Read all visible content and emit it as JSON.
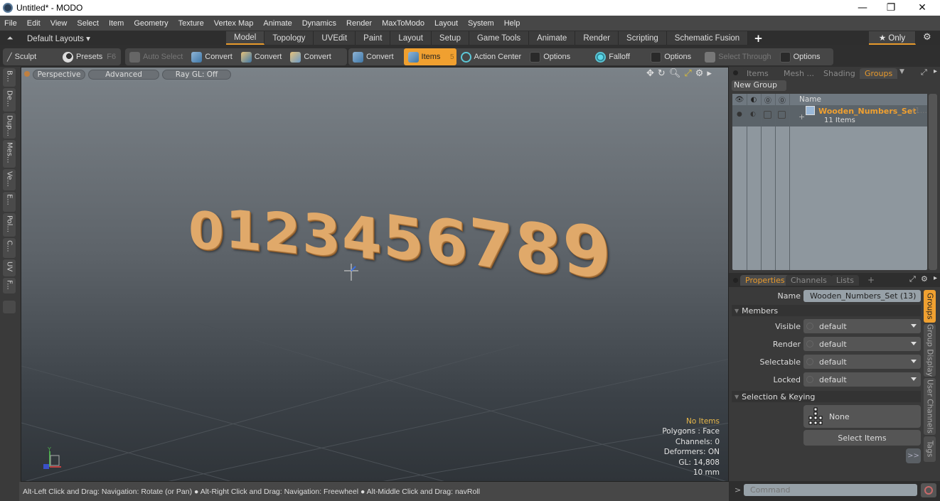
{
  "window": {
    "title": "Untitled* - MODO",
    "minimize_icon": "minimize-icon",
    "maximize_icon": "restore-icon",
    "close_icon": "close-icon",
    "min_glyph": "—",
    "max_glyph": "❐",
    "close_glyph": "✕"
  },
  "menu": [
    "File",
    "Edit",
    "View",
    "Select",
    "Item",
    "Geometry",
    "Texture",
    "Vertex Map",
    "Animate",
    "Dynamics",
    "Render",
    "MaxToModo",
    "Layout",
    "System",
    "Help"
  ],
  "layouts": {
    "dropdown": "Default Layouts ▾",
    "tabs": [
      "Model",
      "Topology",
      "UVEdit",
      "Paint",
      "Layout",
      "Setup",
      "Game Tools",
      "Animate",
      "Render",
      "Scripting",
      "Schematic Fusion"
    ],
    "active": "Model",
    "add": "+",
    "only": "★ Only",
    "accent": "#e89a2c"
  },
  "toolbar": {
    "sculpt": "Sculpt",
    "presets": "Presets",
    "presets_key": "F6",
    "auto_select": "Auto Select",
    "convert": [
      "Convert",
      "Convert",
      "Convert",
      "Convert"
    ],
    "items": "Items",
    "items_count": "5",
    "action_center": "Action Center",
    "options1": "Options",
    "falloff": "Falloff",
    "options2": "Options",
    "select_through": "Select Through",
    "options3": "Options"
  },
  "left_tabs": [
    "B...",
    "De...",
    "Dup...",
    "Mes...",
    "Ve...",
    "E...",
    "Pol...",
    "C...",
    "UV",
    "F..."
  ],
  "viewport": {
    "view_mode": "Perspective",
    "shading": "Advanced",
    "raygl": "Ray GL: Off",
    "model_text": [
      "0",
      "1",
      "2",
      "3",
      "4",
      "5",
      "6",
      "7",
      "8",
      "9"
    ],
    "stats": {
      "items": "No Items",
      "polygons": "Polygons : Face",
      "channels": "Channels: 0",
      "deformers": "Deformers: ON",
      "gl": "GL: 14,808",
      "unit": "10 mm"
    },
    "axis_y": "Y"
  },
  "status": "Alt-Left Click and Drag: Navigation: Rotate (or Pan) ● Alt-Right Click and Drag: Navigation: Freewheel ● Alt-Middle Click and Drag: navRoll",
  "groups_panel": {
    "tabs": [
      "Items",
      "Mesh ...",
      "Shading",
      "Groups"
    ],
    "active": "Groups",
    "new_group": "New Group",
    "col_name": "Name",
    "group_name": "Wooden_Numbers_Set",
    "group_suffix": "(1...",
    "group_count": "11 Items"
  },
  "properties": {
    "tabs": [
      "Properties",
      "Channels",
      "Lists"
    ],
    "add": "+",
    "name_label": "Name",
    "name_value": "Wooden_Numbers_Set (13)",
    "members_section": "Members",
    "rows": [
      {
        "label": "Visible",
        "value": "default"
      },
      {
        "label": "Render",
        "value": "default"
      },
      {
        "label": "Selectable",
        "value": "default"
      },
      {
        "label": "Locked",
        "value": "default"
      }
    ],
    "selection_section": "Selection & Keying",
    "none_label": "None",
    "select_items": "Select Items",
    "more": ">>",
    "side_tabs": [
      "Groups",
      "Group Display",
      "User Channels",
      "Tags"
    ]
  },
  "command": {
    "prompt": ">",
    "placeholder": "Command"
  }
}
